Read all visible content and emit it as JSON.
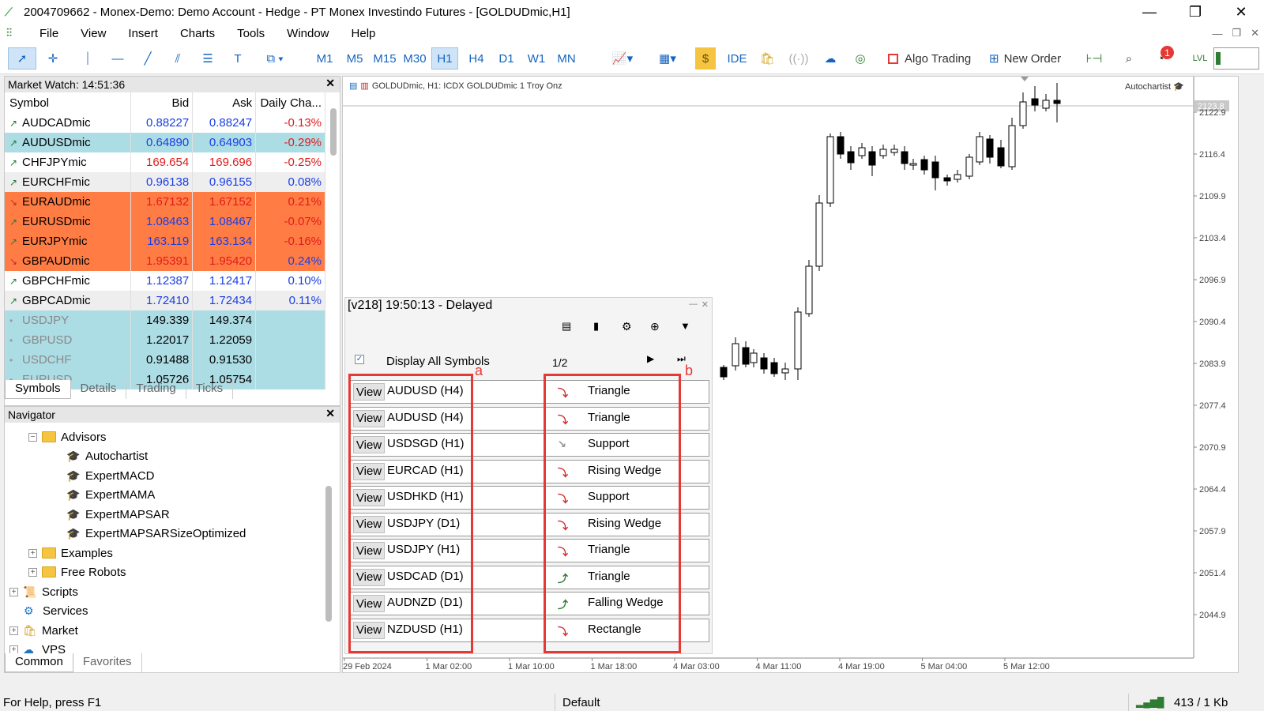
{
  "window": {
    "title": "2004709662 - Monex-Demo: Demo Account - Hedge - PT Monex Investindo Futures - [GOLDUDmic,H1]"
  },
  "menu": [
    "File",
    "View",
    "Insert",
    "Charts",
    "Tools",
    "Window",
    "Help"
  ],
  "toolbar": {
    "timeframes": [
      "M1",
      "M5",
      "M15",
      "M30",
      "H1",
      "H4",
      "D1",
      "W1",
      "MN"
    ],
    "selected_timeframe": "H1",
    "ide_label": "IDE",
    "algo_label": "Algo Trading",
    "new_order_label": "New Order",
    "notification_count": "1"
  },
  "market_watch": {
    "title": "Market Watch: 14:51:36",
    "columns": [
      "Symbol",
      "Bid",
      "Ask",
      "Daily Cha..."
    ],
    "rows": [
      {
        "symbol": "AUDCADmic",
        "bid": "0.88227",
        "ask": "0.88247",
        "change": "-0.13%"
      },
      {
        "symbol": "AUDUSDmic",
        "bid": "0.64890",
        "ask": "0.64903",
        "change": "-0.29%"
      },
      {
        "symbol": "CHFJPYmic",
        "bid": "169.654",
        "ask": "169.696",
        "change": "-0.25%"
      },
      {
        "symbol": "EURCHFmic",
        "bid": "0.96138",
        "ask": "0.96155",
        "change": "0.08%"
      },
      {
        "symbol": "EURAUDmic",
        "bid": "1.67132",
        "ask": "1.67152",
        "change": "0.21%"
      },
      {
        "symbol": "EURUSDmic",
        "bid": "1.08463",
        "ask": "1.08467",
        "change": "-0.07%"
      },
      {
        "symbol": "EURJPYmic",
        "bid": "163.119",
        "ask": "163.134",
        "change": "-0.16%"
      },
      {
        "symbol": "GBPAUDmic",
        "bid": "1.95391",
        "ask": "1.95420",
        "change": "0.24%"
      },
      {
        "symbol": "GBPCHFmic",
        "bid": "1.12387",
        "ask": "1.12417",
        "change": "0.10%"
      },
      {
        "symbol": "GBPCADmic",
        "bid": "1.72410",
        "ask": "1.72434",
        "change": "0.11%"
      },
      {
        "symbol": "USDJPY",
        "bid": "149.339",
        "ask": "149.374",
        "change": ""
      },
      {
        "symbol": "GBPUSD",
        "bid": "1.22017",
        "ask": "1.22059",
        "change": ""
      },
      {
        "symbol": "USDCHF",
        "bid": "0.91488",
        "ask": "0.91530",
        "change": ""
      },
      {
        "symbol": "EURUSD",
        "bid": "1.05726",
        "ask": "1.05754",
        "change": ""
      }
    ],
    "tabs": [
      "Symbols",
      "Details",
      "Trading",
      "Ticks"
    ]
  },
  "navigator": {
    "title": "Navigator",
    "items": {
      "advisors": "Advisors",
      "autochartist": "Autochartist",
      "expertmacd": "ExpertMACD",
      "expertmama": "ExpertMAMA",
      "expertmapsar": "ExpertMAPSAR",
      "expertmapsarsize": "ExpertMAPSARSizeOptimized",
      "examples": "Examples",
      "freerobots": "Free Robots",
      "scripts": "Scripts",
      "services": "Services",
      "market": "Market",
      "vps": "VPS"
    },
    "tabs": [
      "Common",
      "Favorites"
    ]
  },
  "chart": {
    "symbol_label": "GOLDUDmic, H1:  ICDX GOLDUDmic 1 Troy Onz",
    "autochartist_label": "Autochartist",
    "current_price": "2123.8",
    "price_ticks": [
      "2122.9",
      "2116.4",
      "2109.9",
      "2103.4",
      "2096.9",
      "2090.4",
      "2083.9",
      "2077.4",
      "2070.9",
      "2064.4",
      "2057.9",
      "2051.4",
      "2044.9"
    ],
    "time_ticks": [
      "29 Feb 2024",
      "1 Mar 02:00",
      "1 Mar 10:00",
      "1 Mar 18:00",
      "4 Mar 03:00",
      "4 Mar 11:00",
      "4 Mar 19:00",
      "5 Mar 04:00",
      "5 Mar 12:00"
    ]
  },
  "autochartist": {
    "header": "[v218] 19:50:13 - Delayed",
    "display_all": "Display All Symbols",
    "page": "1/2",
    "view_label": "View",
    "marker_a": "a",
    "marker_b": "b",
    "rows": [
      {
        "symbol": "AUDUSD (H4)",
        "pattern": "Triangle",
        "dir": "down"
      },
      {
        "symbol": "AUDUSD (H4)",
        "pattern": "Triangle",
        "dir": "down"
      },
      {
        "symbol": "USDSGD (H1)",
        "pattern": "Support",
        "dir": "neutral"
      },
      {
        "symbol": "EURCAD (H1)",
        "pattern": "Rising Wedge",
        "dir": "down"
      },
      {
        "symbol": "USDHKD (H1)",
        "pattern": "Support",
        "dir": "down"
      },
      {
        "symbol": "USDJPY (D1)",
        "pattern": "Rising Wedge",
        "dir": "down"
      },
      {
        "symbol": "USDJPY (H1)",
        "pattern": "Triangle",
        "dir": "down"
      },
      {
        "symbol": "USDCAD (D1)",
        "pattern": "Triangle",
        "dir": "up"
      },
      {
        "symbol": "AUDNZD (D1)",
        "pattern": "Falling Wedge",
        "dir": "up"
      },
      {
        "symbol": "NZDUSD (H1)",
        "pattern": "Rectangle",
        "dir": "down"
      }
    ]
  },
  "status": {
    "help": "For Help, press F1",
    "profile": "Default",
    "traffic": "413 / 1 Kb"
  }
}
